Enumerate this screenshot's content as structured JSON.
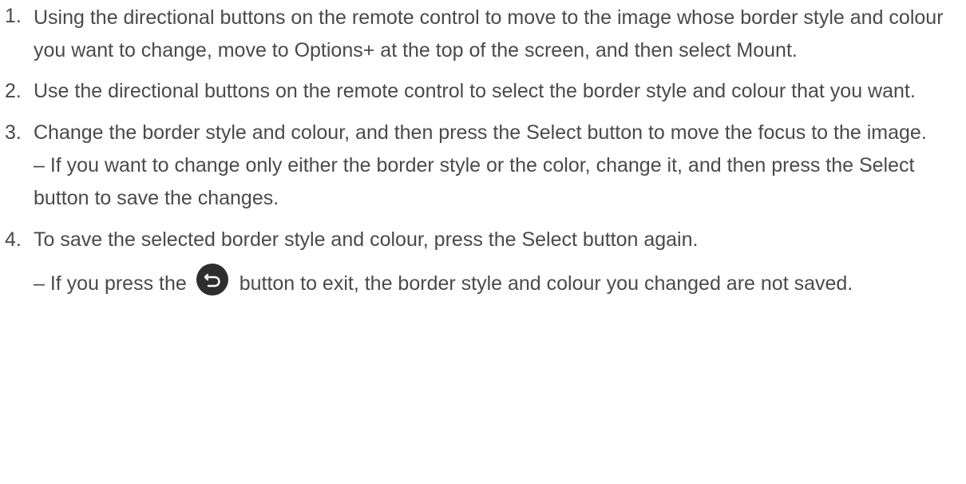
{
  "steps": [
    {
      "number": "1.",
      "text": "Using the directional buttons on the remote control to move to the image whose border style and colour you want to change, move to Options+ at the top of the screen, and then select Mount."
    },
    {
      "number": "2.",
      "text": "Use the directional buttons on the remote control to select the border style and colour that you want."
    },
    {
      "number": "3.",
      "text": "Change the border style and colour, and then press the Select button to move the focus to the image.",
      "note": "– If you want to change only either the border style or the color, change it, and then press the Select button to save the changes."
    },
    {
      "number": "4.",
      "text": "To save the selected border style and colour, press the Select button again.",
      "note_before": "– If you press the",
      "note_icon": "back-button-icon",
      "note_after": "button to exit, the border style and colour you changed are not saved."
    }
  ],
  "colors": {
    "text": "#4a4a4a",
    "icon_bg": "#2e2e2e",
    "icon_fg": "#ffffff"
  }
}
